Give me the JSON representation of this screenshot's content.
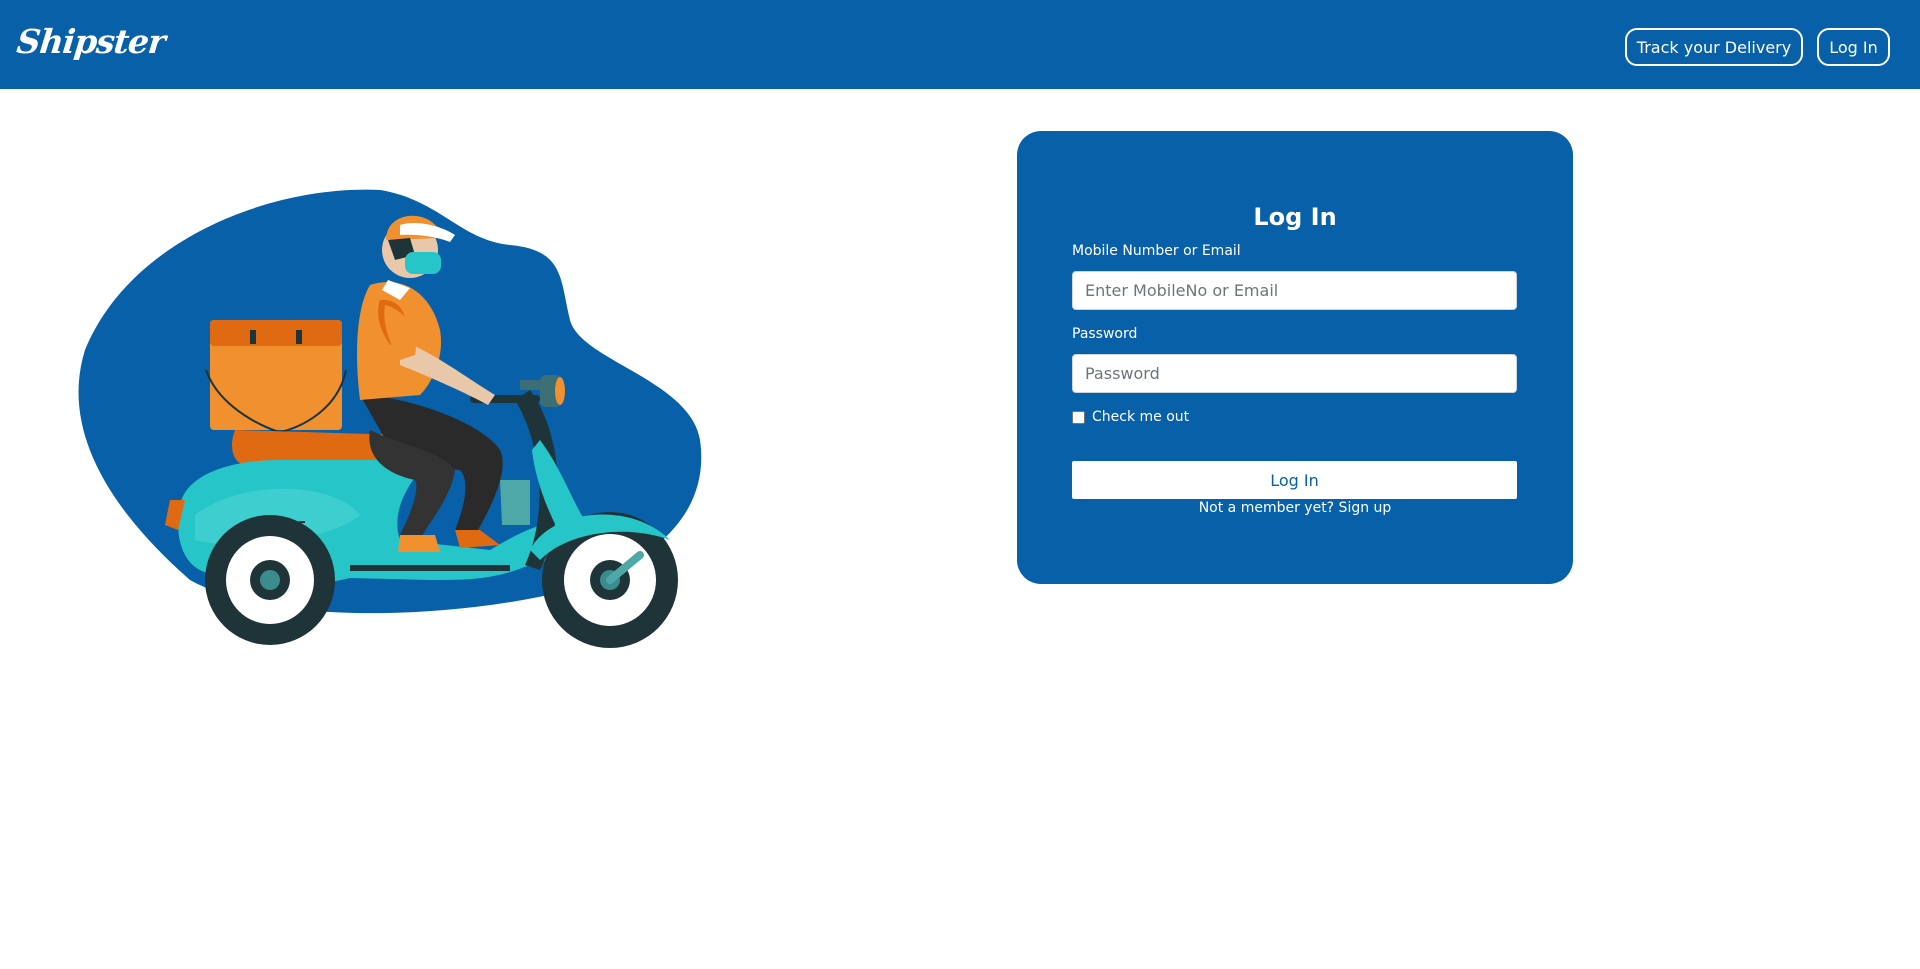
{
  "header": {
    "logo_text": "Shipster",
    "nav": {
      "track_label": "Track your Delivery",
      "login_label": "Log In"
    }
  },
  "illustration": {
    "subject": "delivery-rider-on-scooter",
    "colors": {
      "blob": "#0760a8",
      "scooter": "#26c6c8",
      "box": "#f0902e",
      "tyre": "#1f3438"
    }
  },
  "login_form": {
    "title": "Log In",
    "email_label": "Mobile Number or Email",
    "email_placeholder": "Enter MobileNo or Email",
    "password_label": "Password",
    "password_placeholder": "Password",
    "remember_label": "Check me out",
    "remember_checked": false,
    "submit_label": "Log In",
    "signup_text": "Not a member yet? Sign up"
  },
  "colors": {
    "brand": "#0760a8",
    "white": "#ffffff"
  }
}
